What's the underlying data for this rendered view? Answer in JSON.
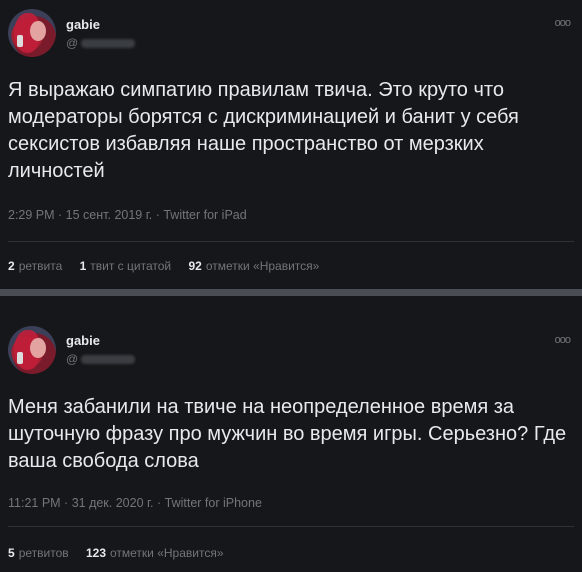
{
  "tweets": [
    {
      "name": "gabie",
      "handle_prefix": "@",
      "more": "ooo",
      "text": "Я выражаю симпатию правилам твича. Это круто что модераторы борятся с дискриминацией и банит у себя сексистов избавляя наше пространство от мерзких личностей",
      "time": "2:29 PM",
      "date": "15 сент. 2019 г.",
      "source": "Twitter for iPad",
      "stats": [
        {
          "value": "2",
          "label": "ретвита"
        },
        {
          "value": "1",
          "label": "твит с цитатой"
        },
        {
          "value": "92",
          "label": "отметки «Нравится»"
        }
      ]
    },
    {
      "name": "gabie",
      "handle_prefix": "@",
      "more": "ooo",
      "text": "Меня забанили на твиче на неопределенное время за шуточную фразу про мужчин во время игры. Серьезно? Где ваша свобода слова",
      "time": "11:21 PM",
      "date": "31 дек. 2020 г.",
      "source": "Twitter for iPhone",
      "stats": [
        {
          "value": "5",
          "label": "ретвитов"
        },
        {
          "value": "123",
          "label": "отметки «Нравится»"
        }
      ]
    }
  ]
}
